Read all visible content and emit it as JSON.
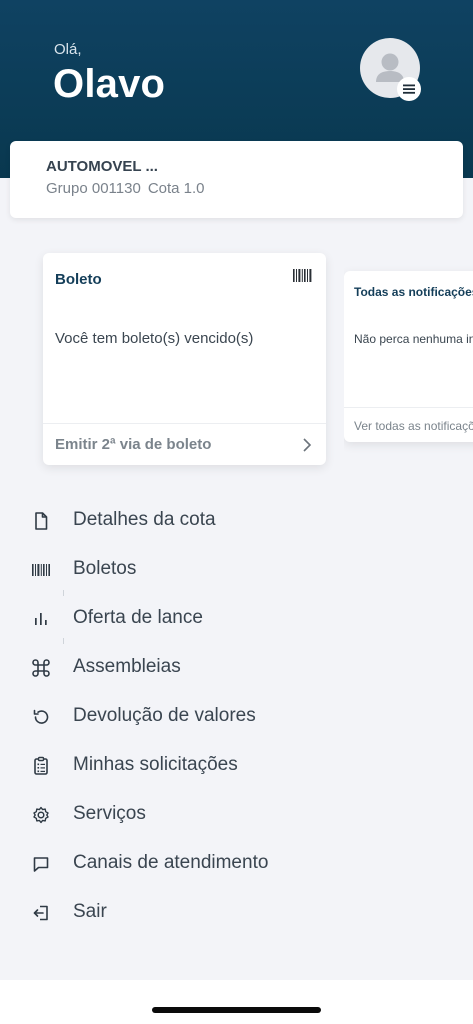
{
  "header": {
    "greeting": "Olá,",
    "user_name": "Olavo",
    "avatar_icon": "user-avatar-icon",
    "menu_icon": "hamburger-menu-icon",
    "background_color": "#0c3d5a"
  },
  "quota_card": {
    "title": "AUTOMOVEL ...",
    "group_label": "Grupo 001130",
    "quota_label": "Cota 1.0"
  },
  "cards": {
    "boleto": {
      "title": "Boleto",
      "message": "Você tem boleto(s) vencido(s)",
      "action_label": "Emitir 2ª via de boleto",
      "icon": "barcode-icon"
    },
    "notifications": {
      "title": "Todas as notificações",
      "message": "Não perca nenhuma inf",
      "action_label": "Ver todas as notificaçõ"
    }
  },
  "menu": {
    "items": [
      {
        "label": "Detalhes da cota",
        "icon": "document-icon"
      },
      {
        "label": "Boletos",
        "icon": "barcode-icon"
      },
      {
        "label": "Oferta de lance",
        "icon": "bar-chart-icon"
      },
      {
        "label": "Assembleias",
        "icon": "command-icon"
      },
      {
        "label": "Devolução de valores",
        "icon": "undo-icon"
      },
      {
        "label": "Minhas solicitações",
        "icon": "clipboard-list-icon"
      },
      {
        "label": "Serviços",
        "icon": "gear-icon"
      },
      {
        "label": "Canais de atendimento",
        "icon": "chat-icon"
      },
      {
        "label": "Sair",
        "icon": "logout-icon"
      }
    ]
  },
  "colors": {
    "primary": "#0f4262",
    "text": "#3a4550",
    "muted": "#7b848c"
  }
}
